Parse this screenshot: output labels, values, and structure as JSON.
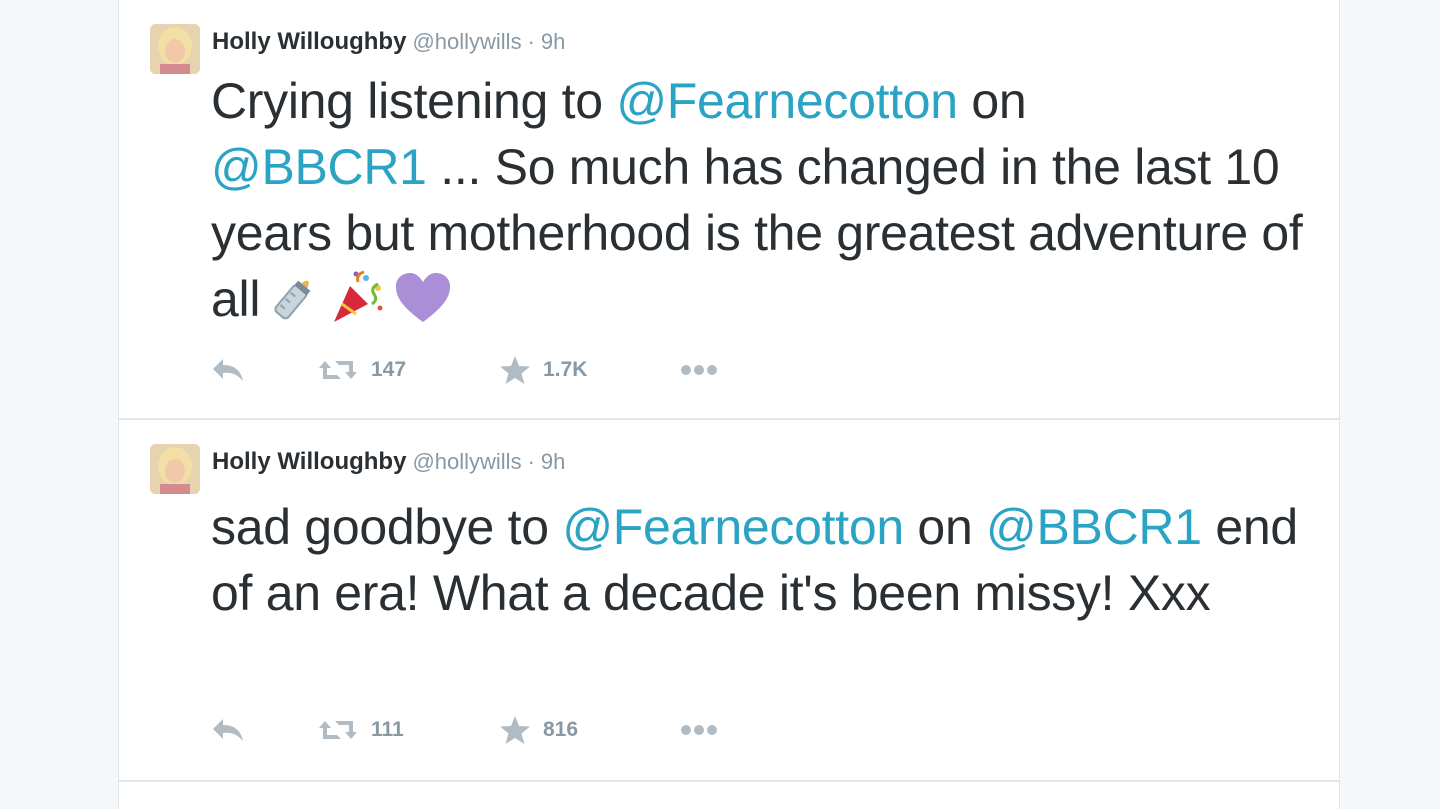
{
  "tweets": [
    {
      "fullname": "Holly Willoughby",
      "username": "@hollywills",
      "separator": "·",
      "time": "9h",
      "text_1": "Crying listening to ",
      "mention_1": "@Fearnecotton",
      "text_2": " on ",
      "mention_2": "@BBCR1",
      "text_3": " ... So much has changed in the last 10 years but motherhood is the greatest adventure of all",
      "emoji": [
        "baby-bottle-icon",
        "party-popper-icon",
        "purple-heart-icon"
      ],
      "retweets": "147",
      "favorites": "1.7K"
    },
    {
      "fullname": "Holly Willoughby",
      "username": "@hollywills",
      "separator": "·",
      "time": "9h",
      "text_1": "sad goodbye to ",
      "mention_1": "@Fearnecotton",
      "text_2": " on ",
      "mention_2": "@BBCR1",
      "text_3": " end of an era! What a decade it's been missy! Xxx",
      "retweets": "111",
      "favorites": "816"
    }
  ],
  "colors": {
    "mention": "#2aa3c4",
    "text": "#292f33",
    "muted": "#8899a6",
    "action_icon": "#b1bbc3",
    "background": "#f5f8fa"
  }
}
